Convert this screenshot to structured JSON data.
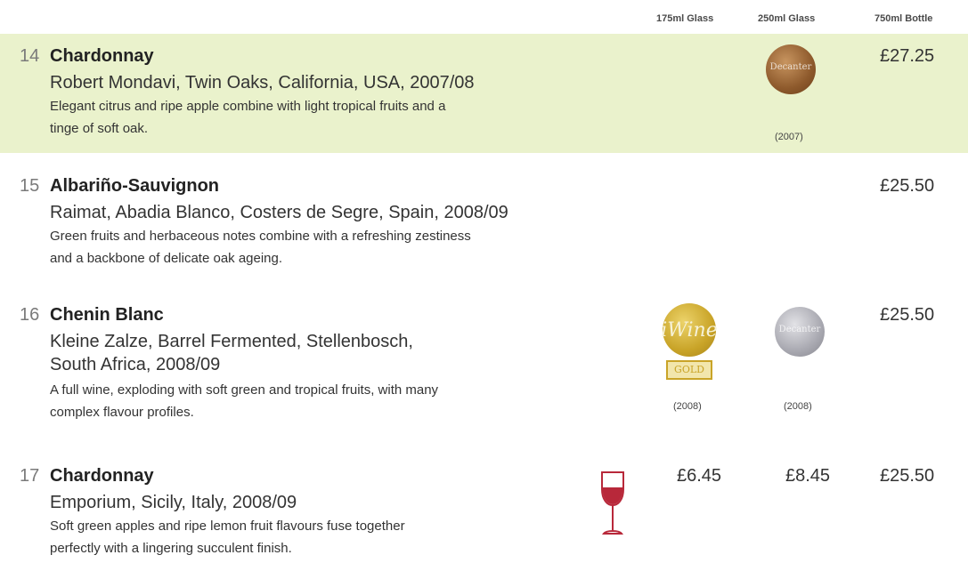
{
  "columns": {
    "glass175": "175ml Glass",
    "glass250": "250ml Glass",
    "bottle": "750ml Bottle"
  },
  "wines": [
    {
      "number": "14",
      "name": "Chardonnay",
      "producer": "Robert Mondavi, Twin Oaks, California, USA, 2007/08",
      "description": [
        "Elegant citrus and ripe apple combine with light tropical fruits and a",
        "tinge of soft oak."
      ],
      "price_bottle": "£27.25",
      "awards": [
        {
          "icon": "decanter-bronze-medal-icon",
          "year": "(2007)"
        }
      ]
    },
    {
      "number": "15",
      "name": "Albariño-Sauvignon",
      "producer": "Raimat, Abadia Blanco, Costers de Segre, Spain, 2008/09",
      "description": [
        "Green fruits and herbaceous notes combine with a refreshing zestiness",
        "and a backbone of delicate oak ageing."
      ],
      "price_bottle": "£25.50"
    },
    {
      "number": "16",
      "name": "Chenin Blanc",
      "producer": [
        "Kleine Zalze, Barrel Fermented, Stellenbosch,",
        "South Africa, 2008/09"
      ],
      "description": [
        "A full wine, exploding with soft green and tropical fruits, with many",
        "complex flavour profiles."
      ],
      "price_bottle": "£25.50",
      "awards": [
        {
          "icon": "iwine-gold-award-icon",
          "year": "(2008)",
          "plaque": "GOLD",
          "word": "iWine"
        },
        {
          "icon": "decanter-silver-medal-icon",
          "year": "(2008)"
        }
      ]
    },
    {
      "number": "17",
      "name": "Chardonnay",
      "producer": "Emporium, Sicily, Italy, 2008/09",
      "description": [
        "Soft green apples and ripe lemon fruit flavours fuse together",
        "perfectly with a lingering succulent finish."
      ],
      "price_175": "£6.45",
      "price_250": "£8.45",
      "price_bottle": "£25.50",
      "icon": "wine-glass-icon"
    }
  ],
  "colors": {
    "highlight": "#eaf2cc",
    "glass_icon": "#b8283a"
  }
}
